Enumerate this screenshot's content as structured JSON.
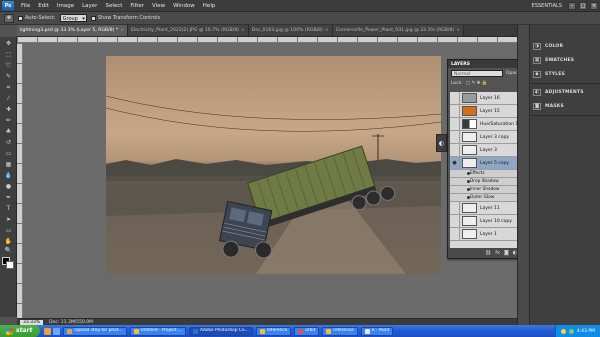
{
  "app": {
    "name": "Ps"
  },
  "menu": [
    "File",
    "Edit",
    "Image",
    "Layer",
    "Select",
    "Filter",
    "View",
    "Window",
    "Help"
  ],
  "workspace_button": "ESSENTIALS",
  "options": {
    "auto_select_label": "Auto-Select:",
    "auto_select_value": "Group",
    "transform_label": "Show Transform Controls"
  },
  "tabs": [
    {
      "label": "lightning3.psd @ 33.3% (Layer 5, RGB/8) *",
      "active": true
    },
    {
      "label": "Electricity_Plant_2022(2).JPG @ 16.7% (RGB/8)",
      "active": false
    },
    {
      "label": "Dsc_0163.jpg @ 100% (RGB/8)",
      "active": false
    },
    {
      "label": "Cornersville_Power_Plant_031.jpg @ 33.3% (RGB/8)",
      "active": false
    }
  ],
  "status": {
    "zoom": "33.33%",
    "doc": "Doc: 11.3M/550.0M"
  },
  "layers_panel": {
    "title": "LAYERS",
    "blend_mode": "Normal",
    "opacity_label": "Opacity:",
    "lock_label": "Lock:",
    "fill_label": "Fill:",
    "layers": [
      {
        "name": "Layer 16",
        "thumb": "#9a9a9a",
        "type": "layer"
      },
      {
        "name": "Layer 15",
        "thumb": "#d26f1e",
        "type": "layer"
      },
      {
        "name": "Hue/Saturation 1",
        "thumb": "#3a3a3a",
        "type": "adjustment"
      },
      {
        "name": "Layer 3 copy",
        "thumb": "#eeeeee",
        "type": "layer"
      },
      {
        "name": "Layer 3",
        "thumb": "#eeeeee",
        "type": "layer"
      },
      {
        "name": "Layer 5 copy",
        "thumb": "#eeeeee",
        "type": "layer",
        "fx": "fx"
      },
      {
        "name": "Effects",
        "type": "fx"
      },
      {
        "name": "Drop Shadow",
        "type": "fx"
      },
      {
        "name": "Inner Shadow",
        "type": "fx"
      },
      {
        "name": "Outer Glow",
        "type": "fx"
      },
      {
        "name": "Layer 11",
        "thumb": "#eeeeee",
        "type": "layer"
      },
      {
        "name": "Layer 10 copy",
        "thumb": "#eeeeee",
        "type": "layer"
      },
      {
        "name": "Layer 1",
        "thumb": "#eeeeee",
        "type": "layer"
      }
    ]
  },
  "dock": [
    {
      "label": "COLOR",
      "icon": "color-icon"
    },
    {
      "label": "SWATCHES",
      "icon": "swatches-icon"
    },
    {
      "label": "STYLES",
      "icon": "styles-icon"
    },
    {
      "label": "ADJUSTMENTS",
      "icon": "adjustments-icon"
    },
    {
      "label": "MASKS",
      "icon": "masks-icon"
    }
  ],
  "taskbar": {
    "start": "start",
    "tasks": [
      {
        "label": "Upload step for phot...",
        "color": "#e8a23b"
      },
      {
        "label": "Untitled - Project ...",
        "color": "#f0c030"
      },
      {
        "label": "Adobe Photoshop CS...",
        "color": "#2c6fd1",
        "active": true
      },
      {
        "label": "reference",
        "color": "#f0c030"
      },
      {
        "label": "orbit",
        "color": "#e05050"
      },
      {
        "label": "reference",
        "color": "#f0c030"
      },
      {
        "label": "e - Paint",
        "color": "#e8e8e8"
      }
    ],
    "clock": "4:43 PM"
  }
}
